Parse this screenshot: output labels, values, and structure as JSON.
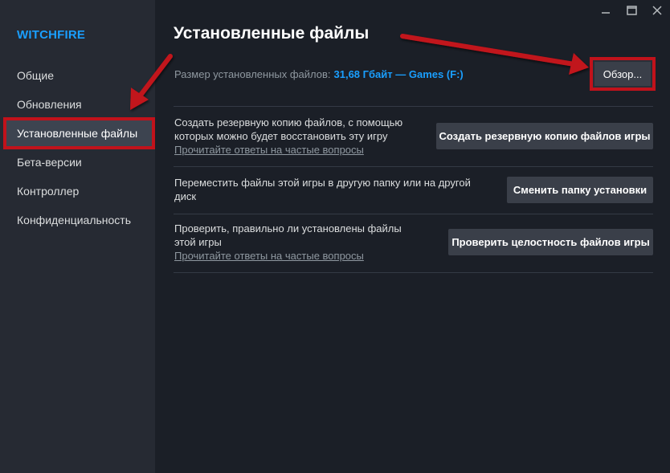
{
  "app": {
    "title": "WITCHFIRE"
  },
  "sidebar": {
    "items": [
      {
        "label": "Общие"
      },
      {
        "label": "Обновления"
      },
      {
        "label": "Установленные файлы"
      },
      {
        "label": "Бета-версии"
      },
      {
        "label": "Контроллер"
      },
      {
        "label": "Конфиденциальность"
      }
    ],
    "active_index": 2
  },
  "window_controls": {
    "minimize": "—",
    "maximize": "☐",
    "close": "✕"
  },
  "main": {
    "title": "Установленные файлы",
    "size_label": "Размер установленных файлов:",
    "size_value": "31,68 Гбайт — Games (F:)",
    "browse_label": "Обзор...",
    "rows": [
      {
        "line1": "Создать резервную копию файлов, с помощью",
        "line2": "которых можно будет восстановить эту игру",
        "link": "Прочитайте ответы на частые вопросы",
        "button": "Создать резервную копию файлов игры"
      },
      {
        "line1": "Переместить файлы этой игры в другую папку или на другой",
        "line2": "диск",
        "button": "Сменить папку установки"
      },
      {
        "line1": "Проверить, правильно ли установлены файлы",
        "line2": "этой игры",
        "link": "Прочитайте ответы на частые вопросы",
        "button": "Проверить целостность файлов игры"
      }
    ]
  },
  "colors": {
    "accent": "#1a9fff",
    "highlight": "#c1121b",
    "background": "#1b1f27",
    "sidebar": "#262a33",
    "button": "#3a3f49"
  }
}
